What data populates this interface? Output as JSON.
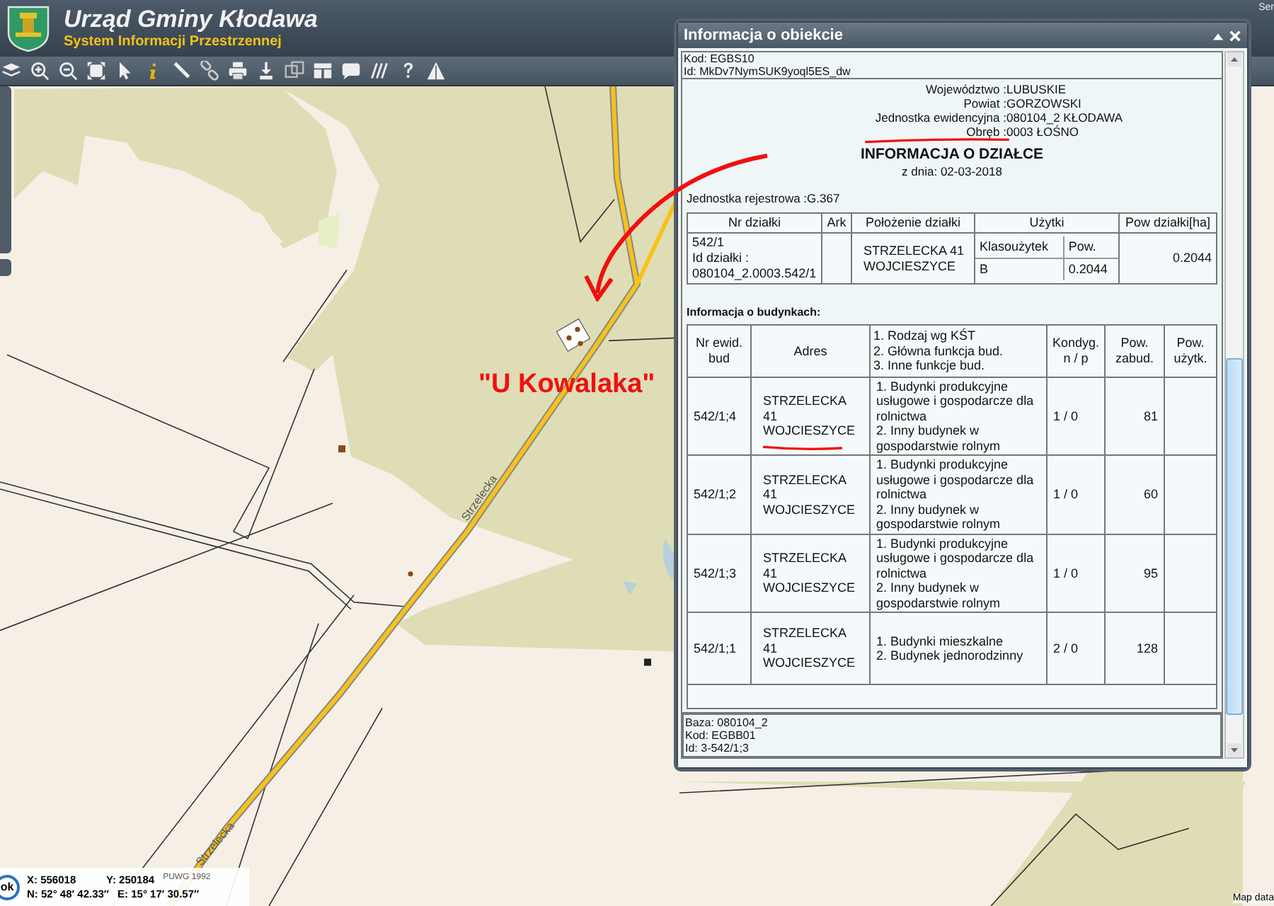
{
  "header": {
    "title": "Urząd Gminy Kłodawa",
    "subtitle": "System Informacji Przestrzennej",
    "server_label": "Ser"
  },
  "map": {
    "street_labels": [
      "Strzelecka",
      "Strzelecka"
    ],
    "annotation": "\"U Kowalaka\"",
    "attribution": "Map data"
  },
  "coordinates": {
    "button": "ok",
    "x": "X: 556018",
    "y": "Y: 250184",
    "system": "PUWG 1992",
    "n": "N: 52° 48′ 42.33″",
    "e": "E: 15° 17′ 30.57″"
  },
  "dialog": {
    "title": "Informacja o obiekcie",
    "header_lines": [
      "Kod: EGBS10",
      "Id: MkDv7NymSUK9yoql5ES_dw"
    ],
    "location": [
      {
        "label": "Województwo :",
        "value": "LUBUSKIE",
        "underlined": false
      },
      {
        "label": "Powiat :",
        "value": "GORZOWSKI",
        "underlined": false
      },
      {
        "label": "Jednostka ewidencyjna :",
        "value": "080104_2 KŁODAWA",
        "underlined": false
      },
      {
        "label": "Obręb :",
        "value": "0003 ŁOŚNO",
        "underlined": true
      }
    ],
    "heading": "INFORMACJA O DZIAŁCE",
    "date": "z dnia: 02-03-2018",
    "registry": "Jednostka rejestrowa :G.367",
    "parcel_table": {
      "columns": [
        "Nr działki",
        "Ark",
        "Położenie działki",
        "Użytki",
        "Pow działki[ha]"
      ],
      "row": {
        "nr": "542/1",
        "id_label": "Id działki :",
        "id": "080104_2.0003.542/1",
        "location": "STRZELECKA 41 WOJCIESZYCE",
        "use_columns": [
          "Klasoużytek",
          "Pow."
        ],
        "uses": [
          [
            "B",
            "0.2044"
          ]
        ],
        "area": "0.2044"
      }
    },
    "buildings_title": "Informacja o budynkach:",
    "buildings_table": {
      "columns": [
        [
          "Nr ewid.",
          "bud"
        ],
        [
          "Adres"
        ],
        [
          "1. Rodzaj wg KŚT",
          "2. Główna funkcja bud.",
          "3. Inne funkcje bud."
        ],
        [
          "Kondyg.",
          "n / p"
        ],
        [
          "Pow.",
          "zabud."
        ],
        [
          "Pow.",
          "użytk."
        ]
      ],
      "rows": [
        {
          "nr": "542/1;4",
          "address": [
            "STRZELECKA",
            "41",
            "WOJCIESZYCE"
          ],
          "underlined": true,
          "functions": [
            "1. Budynki produkcyjne usługowe i gospodarcze dla rolnictwa",
            "2. Inny budynek w gospodarstwie rolnym"
          ],
          "floors": "1 / 0",
          "area": "81"
        },
        {
          "nr": "542/1;2",
          "address": [
            "STRZELECKA",
            "41",
            "WOJCIESZYCE"
          ],
          "underlined": false,
          "functions": [
            "1. Budynki produkcyjne usługowe i gospodarcze dla rolnictwa",
            "2. Inny budynek w gospodarstwie rolnym"
          ],
          "floors": "1 / 0",
          "area": "60"
        },
        {
          "nr": "542/1;3",
          "address": [
            "STRZELECKA",
            "41",
            "WOJCIESZYCE"
          ],
          "underlined": false,
          "functions": [
            "1. Budynki produkcyjne usługowe i gospodarcze dla rolnictwa",
            "2. Inny budynek w gospodarstwie rolnym"
          ],
          "floors": "1 / 0",
          "area": "95"
        },
        {
          "nr": "542/1;1",
          "address": [
            "STRZELECKA",
            "41",
            "WOJCIESZYCE"
          ],
          "underlined": false,
          "functions": [
            "1. Budynki mieszkalne",
            "2. Budynek jednorodzinny"
          ],
          "floors": "2 / 0",
          "area": "128"
        }
      ]
    },
    "footer_lines": [
      "Baza: 080104_2",
      "Kod: EGBB01",
      "Id: 3-542/1;3"
    ]
  }
}
